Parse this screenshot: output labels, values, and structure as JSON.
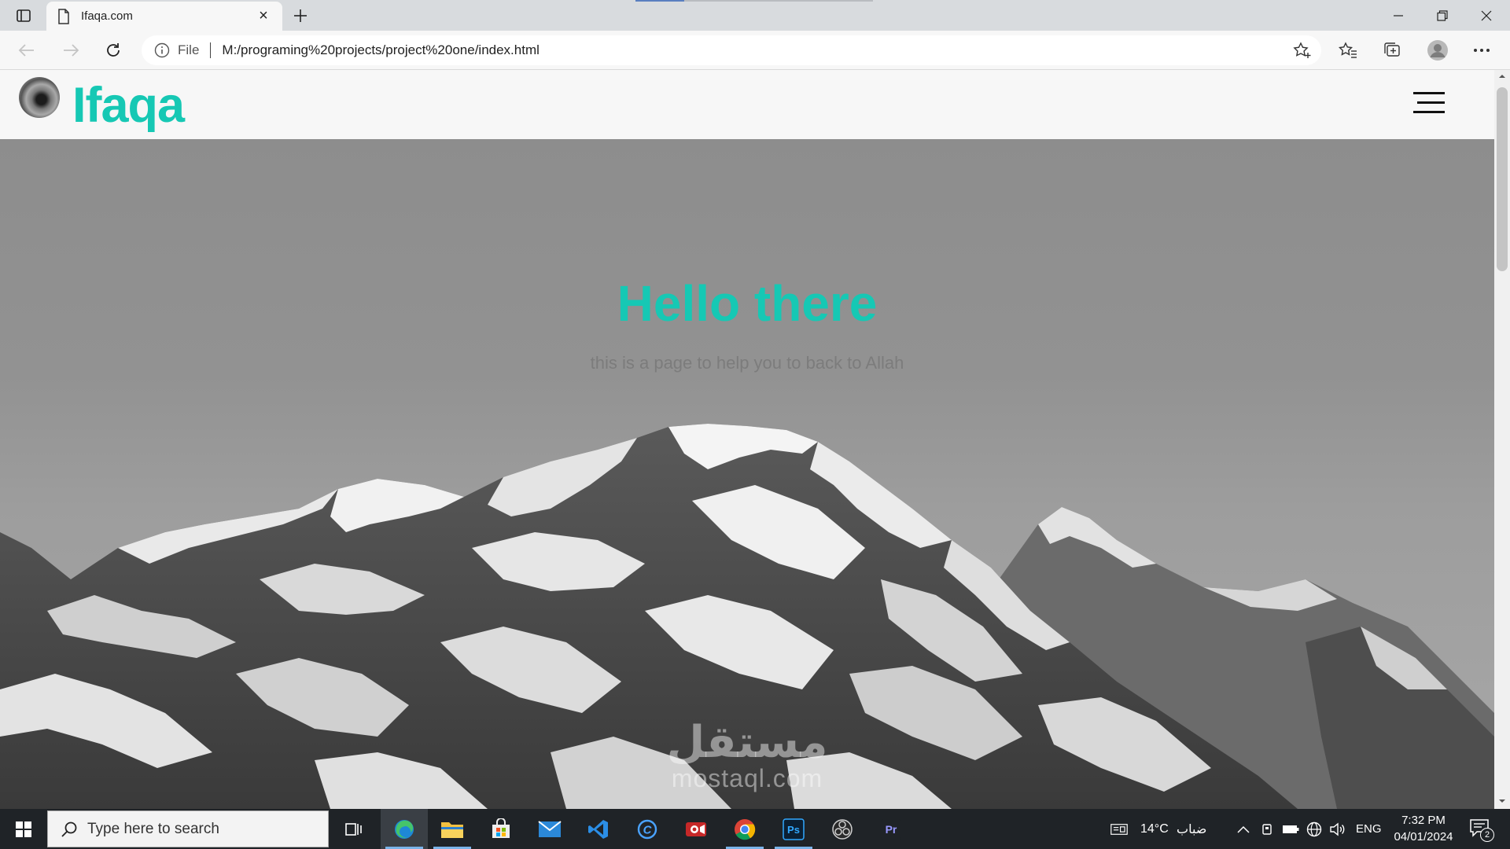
{
  "browser": {
    "tab": {
      "title": "Ifaqa.com",
      "close": "×"
    },
    "address": {
      "scheme": "File",
      "url": "M:/programing%20projects/project%20one/index.html"
    }
  },
  "site": {
    "brand": "Ifaqa",
    "hero": {
      "title": "Hello there",
      "subtitle": "this is a page to help you to back to Allah"
    },
    "watermark": {
      "arabic": "مستقل",
      "latin": "mostaql.com"
    }
  },
  "taskbar": {
    "search_placeholder": "Type here to search",
    "weather": {
      "temperature": "14°C",
      "condition": "ضباب"
    },
    "language": "ENG",
    "time": "7:32 PM",
    "date": "04/01/2024",
    "notification_count": "2"
  },
  "colors": {
    "accent": "#16c8b4",
    "taskbar": "#1f2327",
    "browser_active": "#7ab3e8"
  },
  "icons": {
    "apps": [
      "task-view-icon",
      "edge-icon",
      "file-explorer-icon",
      "ms-store-icon",
      "mail-icon",
      "vscode-icon",
      "cortana-icon",
      "screen-recorder-icon",
      "chrome-icon",
      "photoshop-icon",
      "obs-icon",
      "premiere-icon"
    ]
  }
}
